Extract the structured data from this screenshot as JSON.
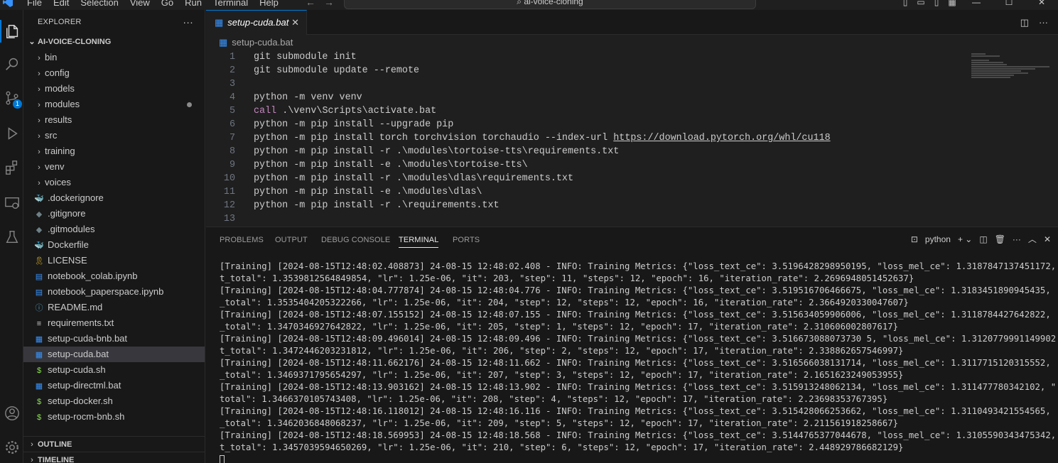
{
  "titlebar": {
    "menu": [
      "File",
      "Edit",
      "Selection",
      "View",
      "Go",
      "Run",
      "Terminal",
      "Help"
    ],
    "search_text": "ai-voice-cloning",
    "search_icon": "search-icon"
  },
  "activity": {
    "icons": [
      "explorer-icon",
      "search-icon",
      "source-control-icon",
      "run-debug-icon",
      "extensions-icon",
      "remote-explorer-icon",
      "testing-icon",
      "account-icon",
      "settings-icon"
    ],
    "source_control_badge": "1"
  },
  "sidebar": {
    "title": "EXPLORER",
    "more": "···",
    "project": "AI-VOICE-CLONING",
    "folders": [
      "bin",
      "config",
      "models",
      "modules",
      "results",
      "src",
      "training",
      "venv",
      "voices"
    ],
    "files": [
      {
        "name": ".dockerignore",
        "icon": "docker-icon",
        "color": "#2496ed"
      },
      {
        "name": ".gitignore",
        "icon": "git-icon",
        "color": "#6d8086"
      },
      {
        "name": ".gitmodules",
        "icon": "git-icon",
        "color": "#6d8086"
      },
      {
        "name": "Dockerfile",
        "icon": "docker-icon",
        "color": "#2496ed"
      },
      {
        "name": "LICENSE",
        "icon": "license-icon",
        "color": "#e6b422"
      },
      {
        "name": "notebook_colab.ipynb",
        "icon": "notebook-icon",
        "color": "#3794ff"
      },
      {
        "name": "notebook_paperspace.ipynb",
        "icon": "notebook-icon",
        "color": "#3794ff"
      },
      {
        "name": "README.md",
        "icon": "info-icon",
        "color": "#519aba"
      },
      {
        "name": "requirements.txt",
        "icon": "text-file-icon",
        "color": "#cccccc"
      },
      {
        "name": "setup-cuda-bnb.bat",
        "icon": "windows-icon",
        "color": "#3794ff"
      },
      {
        "name": "setup-cuda.bat",
        "icon": "windows-icon",
        "color": "#3794ff"
      },
      {
        "name": "setup-cuda.sh",
        "icon": "shell-icon",
        "color": "#89e051"
      },
      {
        "name": "setup-directml.bat",
        "icon": "windows-icon",
        "color": "#3794ff"
      },
      {
        "name": "setup-docker.sh",
        "icon": "shell-icon",
        "color": "#89e051"
      },
      {
        "name": "setup-rocm-bnb.sh",
        "icon": "shell-icon",
        "color": "#89e051"
      }
    ],
    "selected_file": "setup-cuda.bat",
    "outline": "OUTLINE",
    "timeline": "TIMELINE"
  },
  "editor": {
    "tab_label": "setup-cuda.bat",
    "breadcrumb": "setup-cuda.bat",
    "lines": [
      {
        "n": "1",
        "text": "git submodule init"
      },
      {
        "n": "2",
        "text": "git submodule update --remote"
      },
      {
        "n": "3",
        "text": ""
      },
      {
        "n": "4",
        "text": "python -m venv venv"
      },
      {
        "n": "5",
        "kw": "call",
        "text": " .\\venv\\Scripts\\activate.bat"
      },
      {
        "n": "6",
        "text": "python -m pip install --upgrade pip"
      },
      {
        "n": "7",
        "text": "python -m pip install torch torchvision torchaudio --index-url ",
        "url": "https://download.pytorch.org/whl/cu118"
      },
      {
        "n": "8",
        "text": "python -m pip install -r .\\modules\\tortoise-tts\\requirements.txt"
      },
      {
        "n": "9",
        "text": "python -m pip install -e .\\modules\\tortoise-tts\\"
      },
      {
        "n": "10",
        "text": "python -m pip install -r .\\modules\\dlas\\requirements.txt"
      },
      {
        "n": "11",
        "text": "python -m pip install -e .\\modules\\dlas\\"
      },
      {
        "n": "12",
        "text": "python -m pip install -r .\\requirements.txt"
      },
      {
        "n": "13",
        "text": ""
      }
    ]
  },
  "panel": {
    "tabs": [
      "PROBLEMS",
      "OUTPUT",
      "DEBUG CONSOLE",
      "TERMINAL",
      "PORTS"
    ],
    "active_tab": "TERMINAL",
    "terminal_name": "python",
    "terminal_lines": [
      "[Training] [2024-08-15T12:48:02.408873] 24-08-15 12:48:02.408 - INFO: Training Metrics: {\"loss_text_ce\": 3.5196428298950195, \"loss_mel_ce\": 1.3187847137451172, \"loss_gp",
      "t_total\": 1.3539812564849854, \"lr\": 1.25e-06, \"it\": 203, \"step\": 11, \"steps\": 12, \"epoch\": 16, \"iteration_rate\": 2.2696948051452637}",
      "[Training] [2024-08-15T12:48:04.777874] 24-08-15 12:48:04.776 - INFO: Training Metrics: {\"loss_text_ce\": 3.519516706466675, \"loss_mel_ce\": 1.3183451890945435, \"loss_gpt",
      "_total\": 1.3535404205322266, \"lr\": 1.25e-06, \"it\": 204, \"step\": 12, \"steps\": 12, \"epoch\": 16, \"iteration_rate\": 2.3664920330047607}",
      "[Training] [2024-08-15T12:48:07.155152] 24-08-15 12:48:07.155 - INFO: Training Metrics: {\"loss_text_ce\": 3.515634059906006, \"loss_mel_ce\": 1.3118784427642822, \"loss_gpt",
      "_total\": 1.3470346927642822, \"lr\": 1.25e-06, \"it\": 205, \"step\": 1, \"steps\": 12, \"epoch\": 17, \"iteration_rate\": 2.310606002807617}",
      "[Training] [2024-08-15T12:48:09.496014] 24-08-15 12:48:09.496 - INFO: Training Metrics: {\"loss_text_ce\": 3.516673088073730 5, \"loss_mel_ce\": 1.3120779991149902, \"loss_gp",
      "t_total\": 1.3472446203231812, \"lr\": 1.25e-06, \"it\": 206, \"step\": 2, \"steps\": 12, \"epoch\": 17, \"iteration_rate\": 2.338862657546997}",
      "[Training] [2024-08-15T12:48:11.662176] 24-08-15 12:48:11.662 - INFO: Training Metrics: {\"loss_text_ce\": 3.516566038131714, \"loss_mel_ce\": 1.3117715120315552, \"loss_gpt",
      "_total\": 1.3469371795654297, \"lr\": 1.25e-06, \"it\": 207, \"step\": 3, \"steps\": 12, \"epoch\": 17, \"iteration_rate\": 2.1651623249053955}",
      "[Training] [2024-08-15T12:48:13.903162] 24-08-15 12:48:13.902 - INFO: Training Metrics: {\"loss_text_ce\": 3.515913248062134, \"loss_mel_ce\": 1.311477780342102, \"loss_gpt_",
      "total\": 1.3466370105743408, \"lr\": 1.25e-06, \"it\": 208, \"step\": 4, \"steps\": 12, \"epoch\": 17, \"iteration_rate\": 2.23698353767395}",
      "[Training] [2024-08-15T12:48:16.118012] 24-08-15 12:48:16.116 - INFO: Training Metrics: {\"loss_text_ce\": 3.515428066253662, \"loss_mel_ce\": 1.3110493421554565, \"loss_gpt",
      "_total\": 1.3462036848068237, \"lr\": 1.25e-06, \"it\": 209, \"step\": 5, \"steps\": 12, \"epoch\": 17, \"iteration_rate\": 2.211561918258667}",
      "[Training] [2024-08-15T12:48:18.569953] 24-08-15 12:48:18.568 - INFO: Training Metrics: {\"loss_text_ce\": 3.5144765377044678, \"loss_mel_ce\": 1.3105590343475342, \"loss_gp",
      "t_total\": 1.3457039594650269, \"lr\": 1.25e-06, \"it\": 210, \"step\": 6, \"steps\": 12, \"epoch\": 17, \"iteration_rate\": 2.448929786682129}"
    ]
  }
}
